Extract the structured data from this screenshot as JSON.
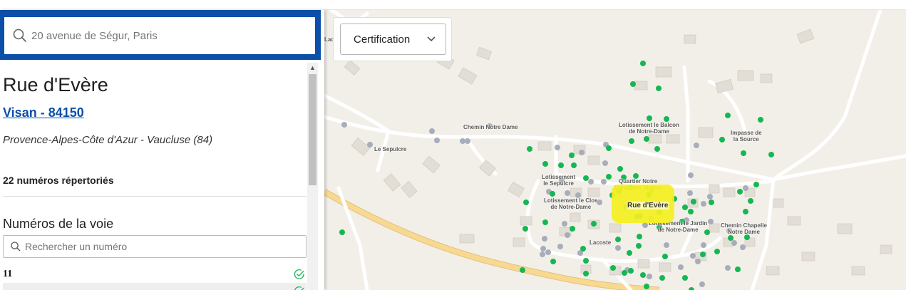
{
  "search": {
    "placeholder": "20 avenue de Ségur, Paris"
  },
  "street": {
    "title": "Rue d'Evère",
    "city_link": "Visan - 84150",
    "region": "Provence-Alpes-Côte d'Azur - Vaucluse (84)",
    "count": "22 numéros répertoriés"
  },
  "numbers": {
    "section_title": "Numéros de la voie",
    "search_placeholder": "Rechercher un numéro",
    "rows": [
      {
        "num": "11",
        "status_icon": "check-circle-icon"
      },
      {
        "num": "",
        "status_icon": "check-circle-icon"
      }
    ]
  },
  "filter": {
    "selected": "Certification"
  },
  "map": {
    "labels": {
      "chemin_nd": "Chemin Notre Dame",
      "sepulcre": "Le Sepulcre",
      "lot_balcon": "Lotissement le Balcon\nde Notre-Dame",
      "impasse_source": "Impasse de\nla Source",
      "lot_sepulcre": "Lotissement\nle Sepulcre",
      "quartier": "Quartier Notre\nDame des Vignes",
      "lot_clos": "Lotissement le Clos\nde Notre-Dame",
      "rue_evere": "Rue d'Evère",
      "lot_jardin": "Lotissement le Jardin\nde Notre-Dame",
      "chemin_chapelle": "Chemin Chapelle\nNotre Dame",
      "lacoste": "Lacoste",
      "edge_label": "Lac"
    },
    "colors": {
      "certified_dot": "#15b752",
      "uncertified_dot": "#a8adbb",
      "highlight": "#f5f01e",
      "road_major": "#f7d992"
    }
  }
}
